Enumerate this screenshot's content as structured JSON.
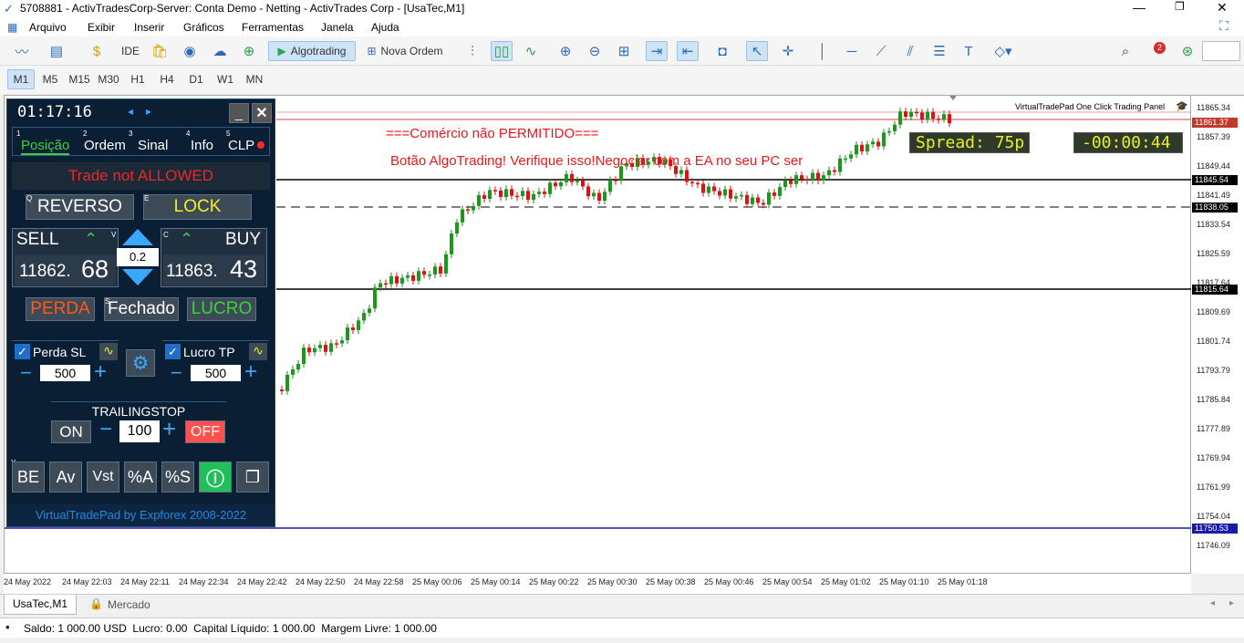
{
  "window": {
    "title": "5708881 - ActivTradesCorp-Server: Conta Demo - Netting - ActivTrades Corp - [UsaTec,M1]"
  },
  "menu": [
    "Arquivo",
    "Exibir",
    "Inserir",
    "Gráficos",
    "Ferramentas",
    "Janela",
    "Ajuda"
  ],
  "toolbar": {
    "ide": "IDE",
    "algotrading": "Algotrading",
    "nova_ordem": "Nova Ordem",
    "notif_count": "2"
  },
  "timeframes": [
    "M1",
    "M5",
    "M15",
    "M30",
    "H1",
    "H4",
    "D1",
    "W1",
    "MN"
  ],
  "chart": {
    "overlay_line1": "===Comércio não PERMITIDO===",
    "overlay_line2": "Botão AlgoTrading! Verifique isso!Negociar com a EA no seu PC ser",
    "panel_title": "VirtualTradePad One Click Trading Panel",
    "spread": "Spread: 75p",
    "timer": "-00:00:44",
    "price_labels": [
      "11865.34",
      "11857.39",
      "11849.44",
      "11841.49",
      "11833.54",
      "11825.59",
      "11817.64",
      "11809.69",
      "11801.74",
      "11793.79",
      "11785.84",
      "11777.89",
      "11769.94",
      "11761.99",
      "11754.04",
      "11746.09"
    ],
    "price_tags": {
      "ask": "11861.37",
      "level1": "11845.54",
      "level2": "11838.05",
      "level3": "11815.64",
      "level4": "11750.53"
    },
    "time_labels": [
      "24 May 2022",
      "24 May 22:03",
      "24 May 22:11",
      "24 May 22:34",
      "24 May 22:42",
      "24 May 22:50",
      "24 May 22:58",
      "25 May 00:06",
      "25 May 00:14",
      "25 May 00:22",
      "25 May 00:30",
      "25 May 00:38",
      "25 May 00:46",
      "25 May 00:54",
      "25 May 01:02",
      "25 May 01:10",
      "25 May 01:18"
    ]
  },
  "vtp": {
    "clock": "01:17:16",
    "tabs": [
      {
        "num": "1",
        "label": "Posição"
      },
      {
        "num": "2",
        "label": "Ordem"
      },
      {
        "num": "3",
        "label": "Sinal"
      },
      {
        "num": "4",
        "label": "Info"
      },
      {
        "num": "5",
        "label": "CLP"
      }
    ],
    "status": "Trade not ALLOWED",
    "reverse": "REVERSO",
    "reverse_key": "Q",
    "lock": "LOCK",
    "lock_key": "E",
    "sell_label": "SELL",
    "sell_key": "V",
    "sell_price_main": "11862.",
    "sell_price_big": "68",
    "buy_label": "BUY",
    "buy_key": "C",
    "buy_price_main": "11863.",
    "buy_price_big": "43",
    "lot": "0.2",
    "perda": "PERDA",
    "fechado": "Fechado",
    "fechado_key": "S",
    "lucro": "LUCRO",
    "sl_label": "Perda SL",
    "sl_value": "500",
    "tp_label": "Lucro TP",
    "tp_value": "500",
    "trailing_title": "TRAILINGSTOP",
    "trail_on": "ON",
    "trail_value": "100",
    "trail_off": "OFF",
    "bottom_buttons": [
      "BE",
      "Av",
      "Vst",
      "%A",
      "%S"
    ],
    "be_key": "Y",
    "footer": "VirtualTradePad by Expforex 2008-2022"
  },
  "tabs": [
    "UsaTec,M1",
    "Mercado"
  ],
  "status_bar": {
    "text": "Saldo: 1 000.00 USD  Lucro: 0.00  Capital Líquido: 1 000.00  Margem Livre: 1 000.00"
  }
}
